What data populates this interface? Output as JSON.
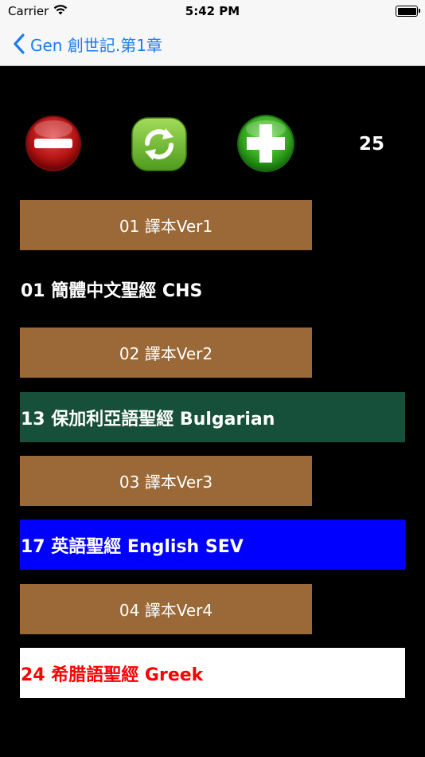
{
  "status_bar": {
    "carrier": "Carrier",
    "time": "5:42 PM",
    "battery_level": 1.0
  },
  "nav": {
    "back_label": "Gen 創世記.第1章"
  },
  "toolbar": {
    "count": "25"
  },
  "rows": [
    {
      "kind": "version",
      "label": "01 譯本Ver1"
    },
    {
      "kind": "bible",
      "label": "01 簡體中文聖經 CHS",
      "bg": "#000000",
      "fg": "#ffffff"
    },
    {
      "kind": "version",
      "label": "02 譯本Ver2"
    },
    {
      "kind": "bible",
      "label": "13 保加利亞語聖經 Bulgarian",
      "bg": "#16503a",
      "fg": "#ffffff"
    },
    {
      "kind": "version",
      "label": "03 譯本Ver3"
    },
    {
      "kind": "bible",
      "label": "17 英語聖經 English SEV",
      "bg": "#0000ff",
      "fg": "#ffffff"
    },
    {
      "kind": "version",
      "label": "04 譯本Ver4"
    },
    {
      "kind": "bible",
      "label": "24 希腊語聖經 Greek",
      "bg": "#ffffff",
      "fg": "#ff0000"
    }
  ],
  "icons": [
    "wifi-icon",
    "battery-icon",
    "back-chevron-icon",
    "minus-icon",
    "refresh-icon",
    "plus-icon"
  ]
}
